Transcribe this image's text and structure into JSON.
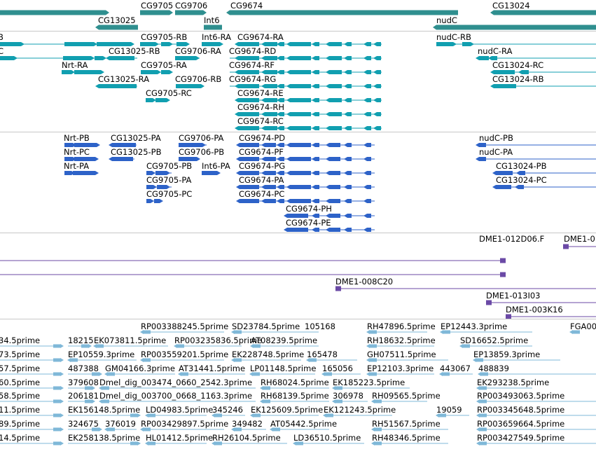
{
  "colors": {
    "gene": "#2f8f8f",
    "transcript": "#119fb0",
    "protein": "#2d62c8",
    "clone": "#6b4aa6",
    "est": "#7fb8d8",
    "divider": "#c8c8c8"
  },
  "tracks": {
    "genes": {
      "features": [
        {
          "label": "CG9705"
        },
        {
          "label": "CG9706"
        },
        {
          "label": "CG9674"
        },
        {
          "label": "CG13024"
        },
        {
          "label": "CG13025"
        },
        {
          "label": "Int6"
        },
        {
          "label": "nudC"
        }
      ]
    },
    "transcripts": {
      "features": [
        {
          "label": "B"
        },
        {
          "label": "C"
        },
        {
          "label": "CG9705-RB"
        },
        {
          "label": "Int6-RA"
        },
        {
          "label": "CG9674-RA"
        },
        {
          "label": "nudC-RB"
        },
        {
          "label": "CG13025-RB"
        },
        {
          "label": "CG9706-RA"
        },
        {
          "label": "CG9674-RD"
        },
        {
          "label": "nudC-RA"
        },
        {
          "label": "Nrt-RA"
        },
        {
          "label": "CG9705-RA"
        },
        {
          "label": "CG9674-RF"
        },
        {
          "label": "CG13024-RC"
        },
        {
          "label": "CG13025-RA"
        },
        {
          "label": "CG9706-RB"
        },
        {
          "label": "CG9674-RG"
        },
        {
          "label": "CG13024-RB"
        },
        {
          "label": "CG9705-RC"
        },
        {
          "label": "CG9674-RE"
        },
        {
          "label": "CG9674-RH"
        },
        {
          "label": "CG9674-RC"
        }
      ]
    },
    "proteins": {
      "features": [
        {
          "label": "Nrt-PB"
        },
        {
          "label": "CG13025-PA"
        },
        {
          "label": "CG9706-PA"
        },
        {
          "label": "CG9674-PD"
        },
        {
          "label": "nudC-PB"
        },
        {
          "label": "Nrt-PC"
        },
        {
          "label": "CG13025-PB"
        },
        {
          "label": "CG9706-PB"
        },
        {
          "label": "CG9674-PF"
        },
        {
          "label": "nudC-PA"
        },
        {
          "label": "Nrt-PA"
        },
        {
          "label": "CG9705-PB"
        },
        {
          "label": "Int6-PA"
        },
        {
          "label": "CG9674-PG"
        },
        {
          "label": "CG13024-PB"
        },
        {
          "label": "CG9705-PA"
        },
        {
          "label": "CG9674-PA"
        },
        {
          "label": "CG13024-PC"
        },
        {
          "label": "CG9705-PC"
        },
        {
          "label": "CG9674-PC"
        },
        {
          "label": "CG9674-PH"
        },
        {
          "label": "CG9674-PE"
        }
      ]
    },
    "clones": {
      "features": [
        {
          "label": "DME1-012D06.F"
        },
        {
          "label": "DME1-0"
        },
        {
          "label": "DME1-008C20"
        },
        {
          "label": "DME1-013I03"
        },
        {
          "label": "DME1-003K16"
        }
      ]
    },
    "ests": {
      "features": [
        {
          "label": "RP003388245.5prime"
        },
        {
          "label": "SD23784.5prime"
        },
        {
          "label": "105168"
        },
        {
          "label": "RH47896.5prime"
        },
        {
          "label": "EP12443.3prime"
        },
        {
          "label": "FGA00"
        },
        {
          "label": "34.5prime"
        },
        {
          "label": "18215"
        },
        {
          "label": "EK073811.5prime"
        },
        {
          "label": "RP003235836.5prime"
        },
        {
          "label": "AT08239.5prime"
        },
        {
          "label": "RH18632.5prime"
        },
        {
          "label": "SD16652.5prime"
        },
        {
          "label": "73.5prime"
        },
        {
          "label": "EP10559.3prime"
        },
        {
          "label": "RP003559201.5prime"
        },
        {
          "label": "EK228748.5prime"
        },
        {
          "label": "165478"
        },
        {
          "label": "GH07511.5prime"
        },
        {
          "label": "EP13859.3prime"
        },
        {
          "label": "57.5prime"
        },
        {
          "label": "487388"
        },
        {
          "label": "GM04166.3prime"
        },
        {
          "label": "AT31441.5prime"
        },
        {
          "label": "LP01148.5prime"
        },
        {
          "label": "165056"
        },
        {
          "label": "EP12103.3prime"
        },
        {
          "label": "443067"
        },
        {
          "label": "488839"
        },
        {
          "label": "60.5prime"
        },
        {
          "label": "379608"
        },
        {
          "label": "Dmel_dig_003474_0660_2542.3prime"
        },
        {
          "label": "RH68024.5prime"
        },
        {
          "label": "EK185223.5prime"
        },
        {
          "label": "EK293238.5prime"
        },
        {
          "label": "58.5prime"
        },
        {
          "label": "206181"
        },
        {
          "label": "Dmel_dig_003700_0668_1163.3prime"
        },
        {
          "label": "RH68139.5prime"
        },
        {
          "label": "306978"
        },
        {
          "label": "RH09565.5prime"
        },
        {
          "label": "RP003493063.5prime"
        },
        {
          "label": "11.5prime"
        },
        {
          "label": "EK156148.5prime"
        },
        {
          "label": "LD04983.5prime"
        },
        {
          "label": "345246"
        },
        {
          "label": "EK125609.5prime"
        },
        {
          "label": "EK121243.5prime"
        },
        {
          "label": "19059"
        },
        {
          "label": "RP003345648.5prime"
        },
        {
          "label": "89.5prime"
        },
        {
          "label": "324675"
        },
        {
          "label": "376019"
        },
        {
          "label": "RP003429897.5prime"
        },
        {
          "label": "349482"
        },
        {
          "label": "AT05442.5prime"
        },
        {
          "label": "RH51567.5prime"
        },
        {
          "label": "RP003659664.5prime"
        },
        {
          "label": "14.5prime"
        },
        {
          "label": "EK258138.5prime"
        },
        {
          "label": "HL01412.5prime"
        },
        {
          "label": "RH26104.5prime"
        },
        {
          "label": "LD36510.5prime"
        },
        {
          "label": "RH48346.5prime"
        },
        {
          "label": "RP003427549.5prime"
        }
      ]
    }
  }
}
